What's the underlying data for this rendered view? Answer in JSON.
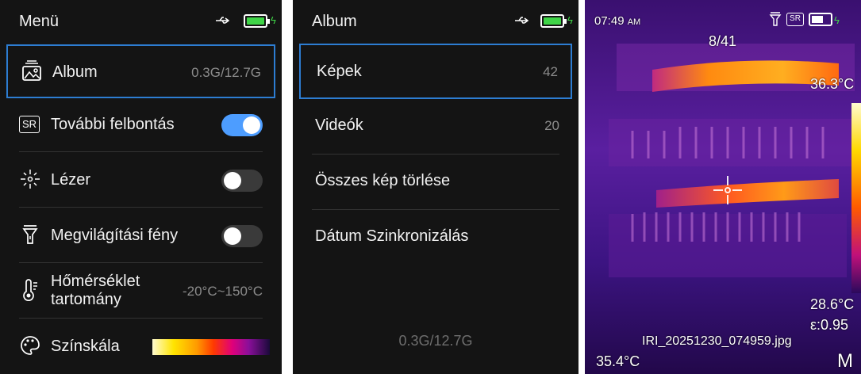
{
  "menu": {
    "title": "Menü",
    "items": [
      {
        "label": "Album",
        "value": "0.3G/12.7G",
        "icon": "album-icon"
      },
      {
        "label": "További felbontás",
        "state": "on",
        "icon": "sr-icon",
        "icon_text": "SR"
      },
      {
        "label": "Lézer",
        "state": "off",
        "icon": "laser-icon"
      },
      {
        "label": "Megvilágítási fény",
        "state": "off",
        "icon": "flashlight-icon"
      },
      {
        "label_line1": "Hőmérséklet",
        "label_line2": "tartomány",
        "value": "-20°C~150°C",
        "icon": "thermometer-icon"
      },
      {
        "label": "Színskála",
        "icon": "palette-icon"
      }
    ]
  },
  "album": {
    "title": "Album",
    "items": [
      {
        "label": "Képek",
        "value": "42"
      },
      {
        "label": "Videók",
        "value": "20"
      },
      {
        "label": "Összes kép törlése"
      },
      {
        "label": "Dátum Szinkronizálás"
      }
    ],
    "storage": "0.3G/12.7G"
  },
  "viewer": {
    "time": "07:49",
    "ampm": "AM",
    "counter": "8/41",
    "sr_badge": "SR",
    "max_temp": "36.3°C",
    "min_temp": "28.6°C",
    "emissivity": "ε:0.95",
    "center_temp": "35.4°C",
    "filename": "IRI_20251230_074959.jpg",
    "mode_letter": "M"
  },
  "colors": {
    "accent": "#2d7dd2",
    "toggle_on": "#4d9dff",
    "battery": "#3fd447",
    "background": "#141414"
  },
  "status": {
    "usb": "usb-icon",
    "battery": "battery-icon"
  }
}
